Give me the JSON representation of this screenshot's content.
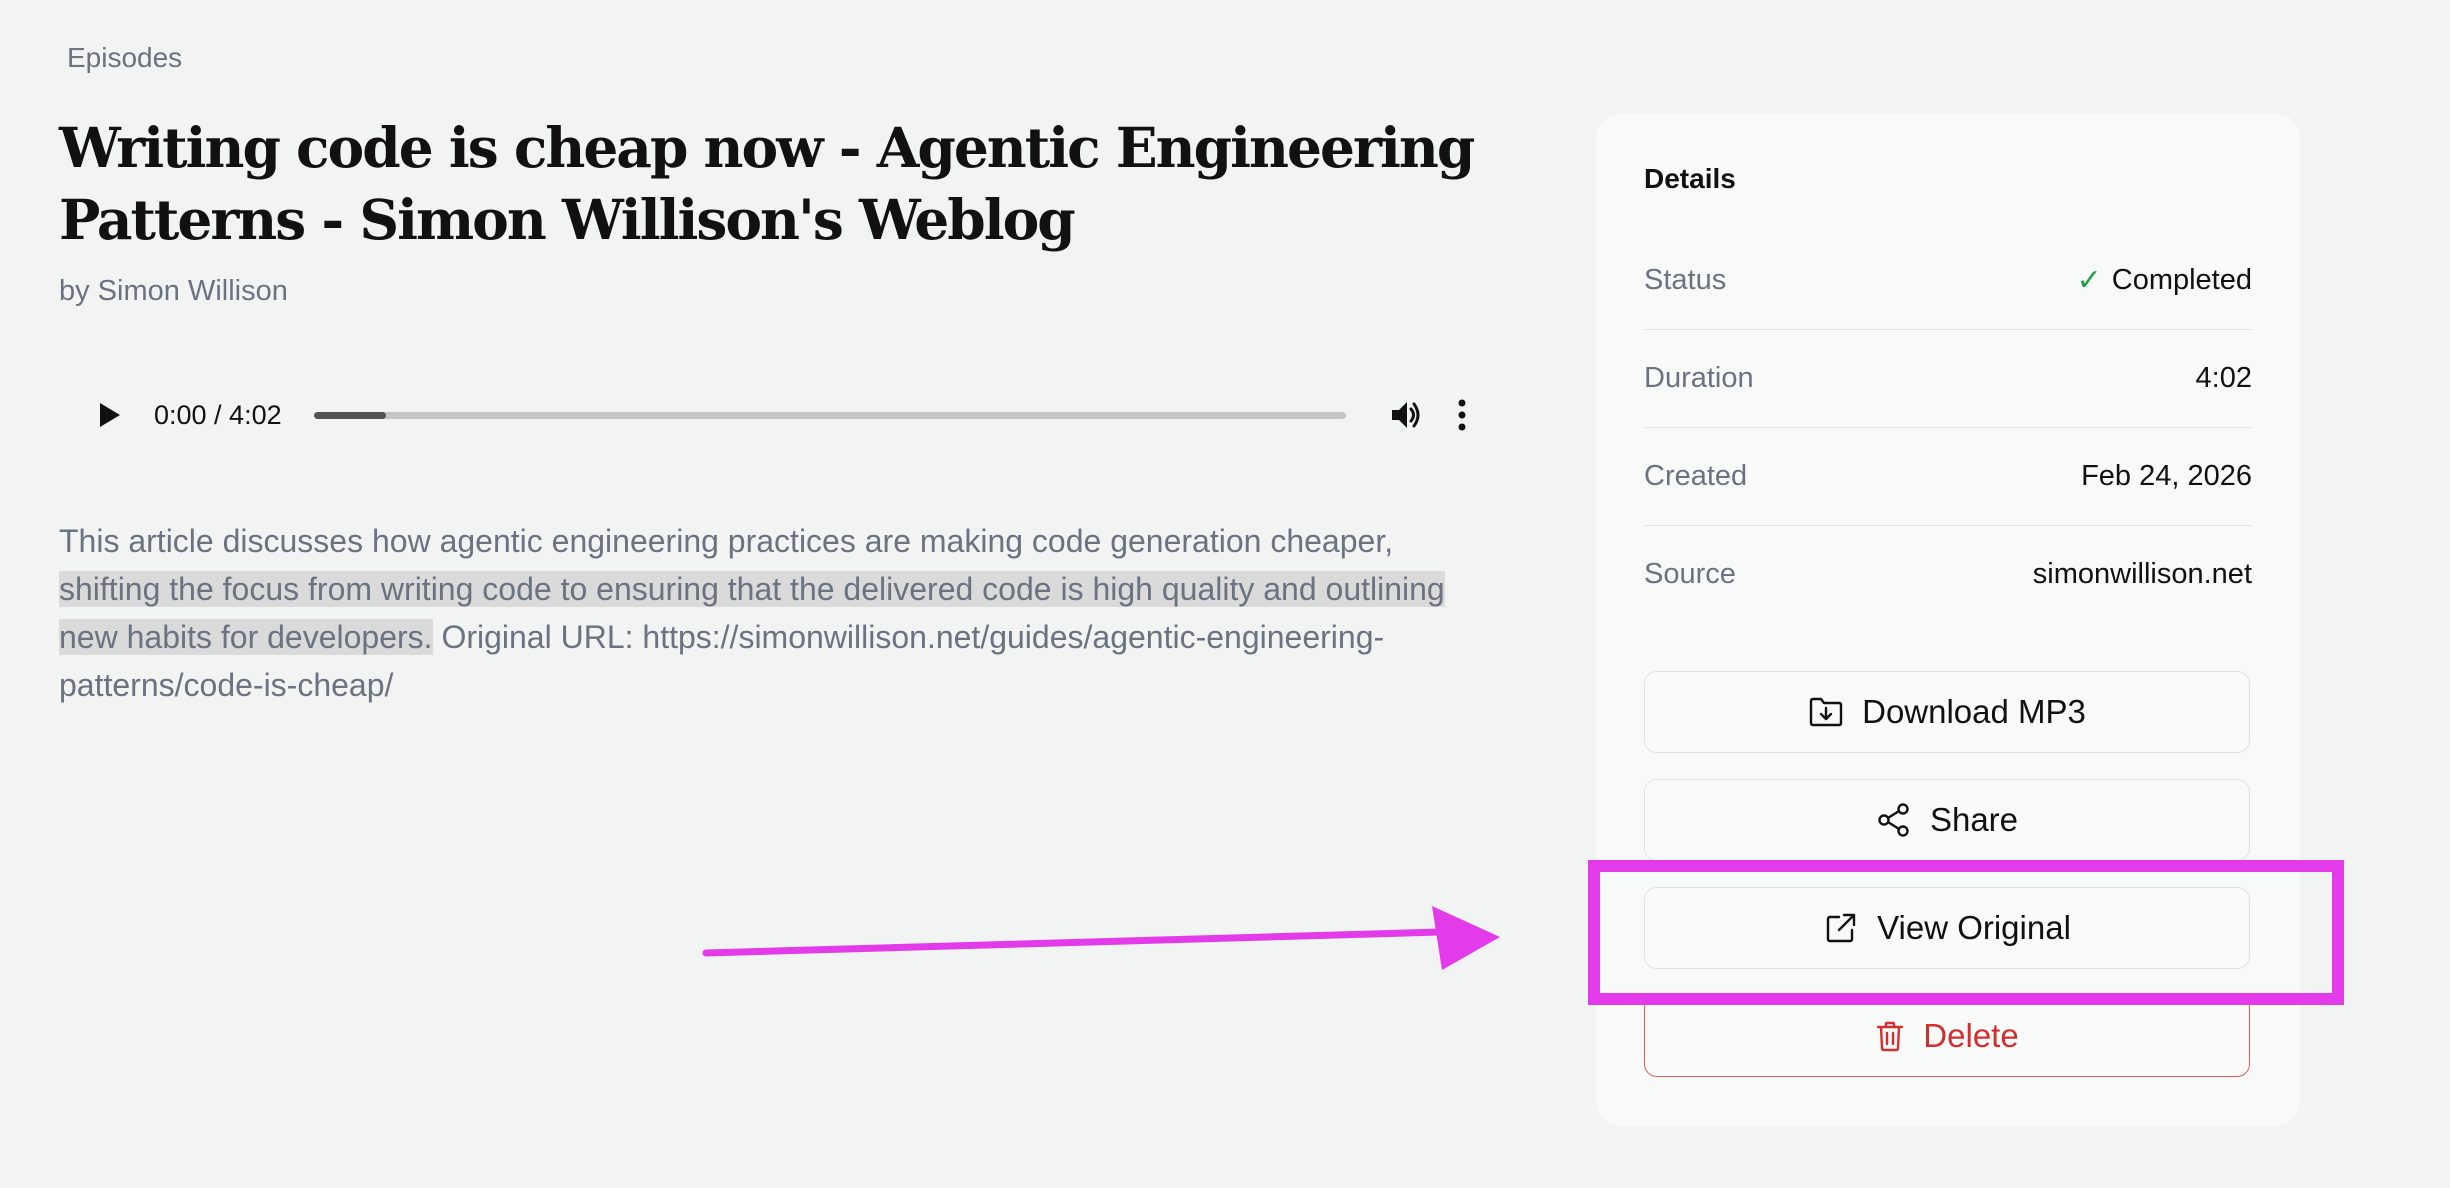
{
  "breadcrumb": {
    "label": "Episodes"
  },
  "episode": {
    "title": "Writing code is cheap now - Agentic Engineering Patterns - Simon Willison's Weblog",
    "byline": "by Simon Willison",
    "description_plain_start": "This article discusses how agentic engineering practices are making code generation cheaper, ",
    "description_highlighted": "shifting the focus from writing code to ensuring that the delivered code is high quality and outlining new habits for developers.",
    "description_plain_end": " Original URL: https://simonwillison.net/guides/agentic-engineering-patterns/code-is-cheap/"
  },
  "player": {
    "time": "0:00 / 4:02",
    "progress": 0.07,
    "icons": [
      "play-icon",
      "volume-icon",
      "more-vertical-icon"
    ]
  },
  "details": {
    "title": "Details",
    "rows": [
      {
        "key": "Status",
        "value": "Completed",
        "icon": "check-icon",
        "color": "#22a04b"
      },
      {
        "key": "Duration",
        "value": "4:02"
      },
      {
        "key": "Created",
        "value": "Feb 24, 2026"
      },
      {
        "key": "Source",
        "value": "simonwillison.net"
      }
    ],
    "buttons": {
      "download": {
        "label": "Download MP3",
        "icon": "download-folder-icon"
      },
      "share": {
        "label": "Share",
        "icon": "share-icon"
      },
      "view_original": {
        "label": "View Original",
        "icon": "external-link-icon"
      },
      "delete": {
        "label": "Delete",
        "icon": "trash-icon",
        "color": "#d32f2f"
      }
    }
  },
  "annotation": {
    "color": "#e33be9"
  }
}
